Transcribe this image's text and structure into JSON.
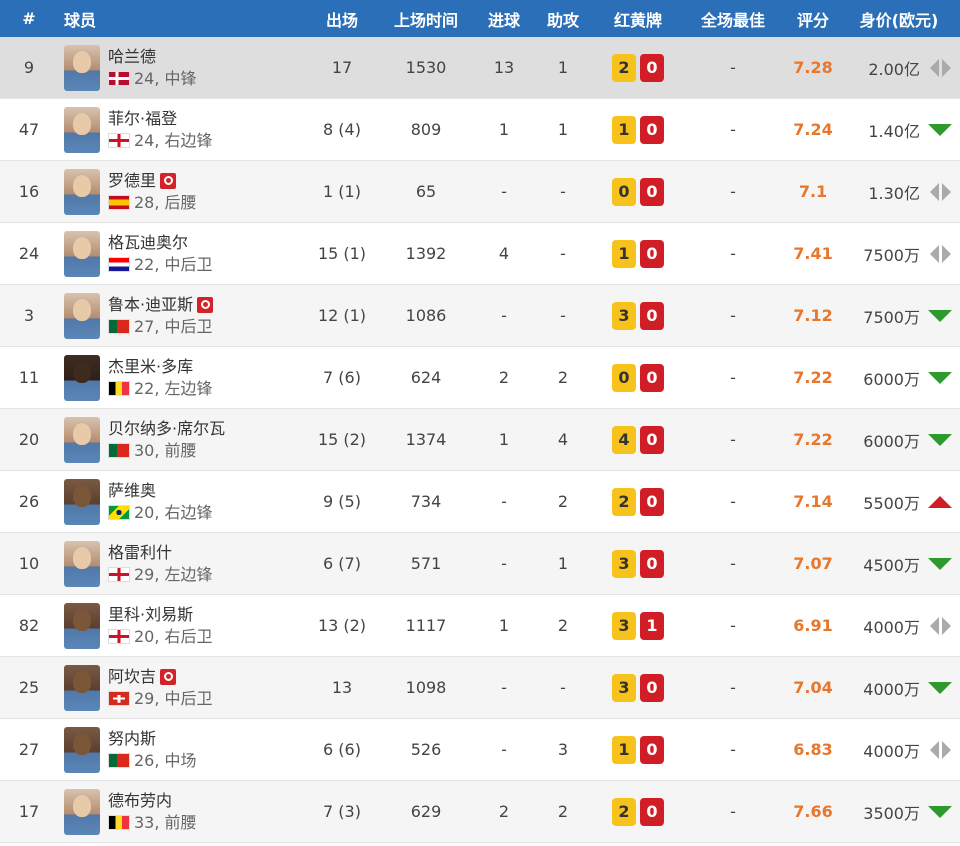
{
  "headers": {
    "num": "#",
    "player": "球员",
    "app": "出场",
    "minutes": "上场时间",
    "goals": "进球",
    "assists": "助攻",
    "cards": "红黄牌",
    "motm": "全场最佳",
    "rating": "评分",
    "value": "身价(欧元)"
  },
  "colors": {
    "header_bg": "#2a6fb8",
    "rating": "#e8762b",
    "yellow_card": "#f6c21b",
    "red_card": "#d11e26",
    "trend_down": "#2e9a2e",
    "trend_up": "#d11e26",
    "trend_flat": "#aaaaaa"
  },
  "players": [
    {
      "num": "9",
      "name": "哈兰德",
      "sub": "24, 中锋",
      "flag": "norway",
      "injury": false,
      "app": "17",
      "minutes": "1530",
      "goals": "13",
      "assists": "1",
      "yellow": "2",
      "red": "0",
      "motm": "-",
      "rating": "7.28",
      "value": "2.00亿",
      "trend": "flat"
    },
    {
      "num": "47",
      "name": "菲尔·福登",
      "sub": "24, 右边锋",
      "flag": "england",
      "injury": false,
      "app": "8 (4)",
      "minutes": "809",
      "goals": "1",
      "assists": "1",
      "yellow": "1",
      "red": "0",
      "motm": "-",
      "rating": "7.24",
      "value": "1.40亿",
      "trend": "down"
    },
    {
      "num": "16",
      "name": "罗德里",
      "sub": "28, 后腰",
      "flag": "spain",
      "injury": true,
      "app": "1 (1)",
      "minutes": "65",
      "goals": "-",
      "assists": "-",
      "yellow": "0",
      "red": "0",
      "motm": "-",
      "rating": "7.1",
      "value": "1.30亿",
      "trend": "flat"
    },
    {
      "num": "24",
      "name": "格瓦迪奥尔",
      "sub": "22, 中后卫",
      "flag": "croatia",
      "injury": false,
      "app": "15 (1)",
      "minutes": "1392",
      "goals": "4",
      "assists": "-",
      "yellow": "1",
      "red": "0",
      "motm": "-",
      "rating": "7.41",
      "value": "7500万",
      "trend": "flat"
    },
    {
      "num": "3",
      "name": "鲁本·迪亚斯",
      "sub": "27, 中后卫",
      "flag": "portugal",
      "injury": true,
      "app": "12 (1)",
      "minutes": "1086",
      "goals": "-",
      "assists": "-",
      "yellow": "3",
      "red": "0",
      "motm": "-",
      "rating": "7.12",
      "value": "7500万",
      "trend": "down"
    },
    {
      "num": "11",
      "name": "杰里米·多库",
      "sub": "22, 左边锋",
      "flag": "belgium",
      "injury": false,
      "app": "7 (6)",
      "minutes": "624",
      "goals": "2",
      "assists": "2",
      "yellow": "0",
      "red": "0",
      "motm": "-",
      "rating": "7.22",
      "value": "6000万",
      "trend": "down"
    },
    {
      "num": "20",
      "name": "贝尔纳多·席尔瓦",
      "sub": "30, 前腰",
      "flag": "portugal",
      "injury": false,
      "app": "15 (2)",
      "minutes": "1374",
      "goals": "1",
      "assists": "4",
      "yellow": "4",
      "red": "0",
      "motm": "-",
      "rating": "7.22",
      "value": "6000万",
      "trend": "down"
    },
    {
      "num": "26",
      "name": "萨维奥",
      "sub": "20, 右边锋",
      "flag": "brazil",
      "injury": false,
      "app": "9 (5)",
      "minutes": "734",
      "goals": "-",
      "assists": "2",
      "yellow": "2",
      "red": "0",
      "motm": "-",
      "rating": "7.14",
      "value": "5500万",
      "trend": "up"
    },
    {
      "num": "10",
      "name": "格雷利什",
      "sub": "29, 左边锋",
      "flag": "england",
      "injury": false,
      "app": "6 (7)",
      "minutes": "571",
      "goals": "-",
      "assists": "1",
      "yellow": "3",
      "red": "0",
      "motm": "-",
      "rating": "7.07",
      "value": "4500万",
      "trend": "down"
    },
    {
      "num": "82",
      "name": "里科·刘易斯",
      "sub": "20, 右后卫",
      "flag": "england",
      "injury": false,
      "app": "13 (2)",
      "minutes": "1117",
      "goals": "1",
      "assists": "2",
      "yellow": "3",
      "red": "1",
      "motm": "-",
      "rating": "6.91",
      "value": "4000万",
      "trend": "flat"
    },
    {
      "num": "25",
      "name": "阿坎吉",
      "sub": "29, 中后卫",
      "flag": "switzerland",
      "injury": true,
      "app": "13",
      "minutes": "1098",
      "goals": "-",
      "assists": "-",
      "yellow": "3",
      "red": "0",
      "motm": "-",
      "rating": "7.04",
      "value": "4000万",
      "trend": "down"
    },
    {
      "num": "27",
      "name": "努内斯",
      "sub": "26, 中场",
      "flag": "portugal",
      "injury": false,
      "app": "6 (6)",
      "minutes": "526",
      "goals": "-",
      "assists": "3",
      "yellow": "1",
      "red": "0",
      "motm": "-",
      "rating": "6.83",
      "value": "4000万",
      "trend": "flat"
    },
    {
      "num": "17",
      "name": "德布劳内",
      "sub": "33, 前腰",
      "flag": "belgium",
      "injury": false,
      "app": "7 (3)",
      "minutes": "629",
      "goals": "2",
      "assists": "2",
      "yellow": "2",
      "red": "0",
      "motm": "-",
      "rating": "7.66",
      "value": "3500万",
      "trend": "down"
    }
  ]
}
